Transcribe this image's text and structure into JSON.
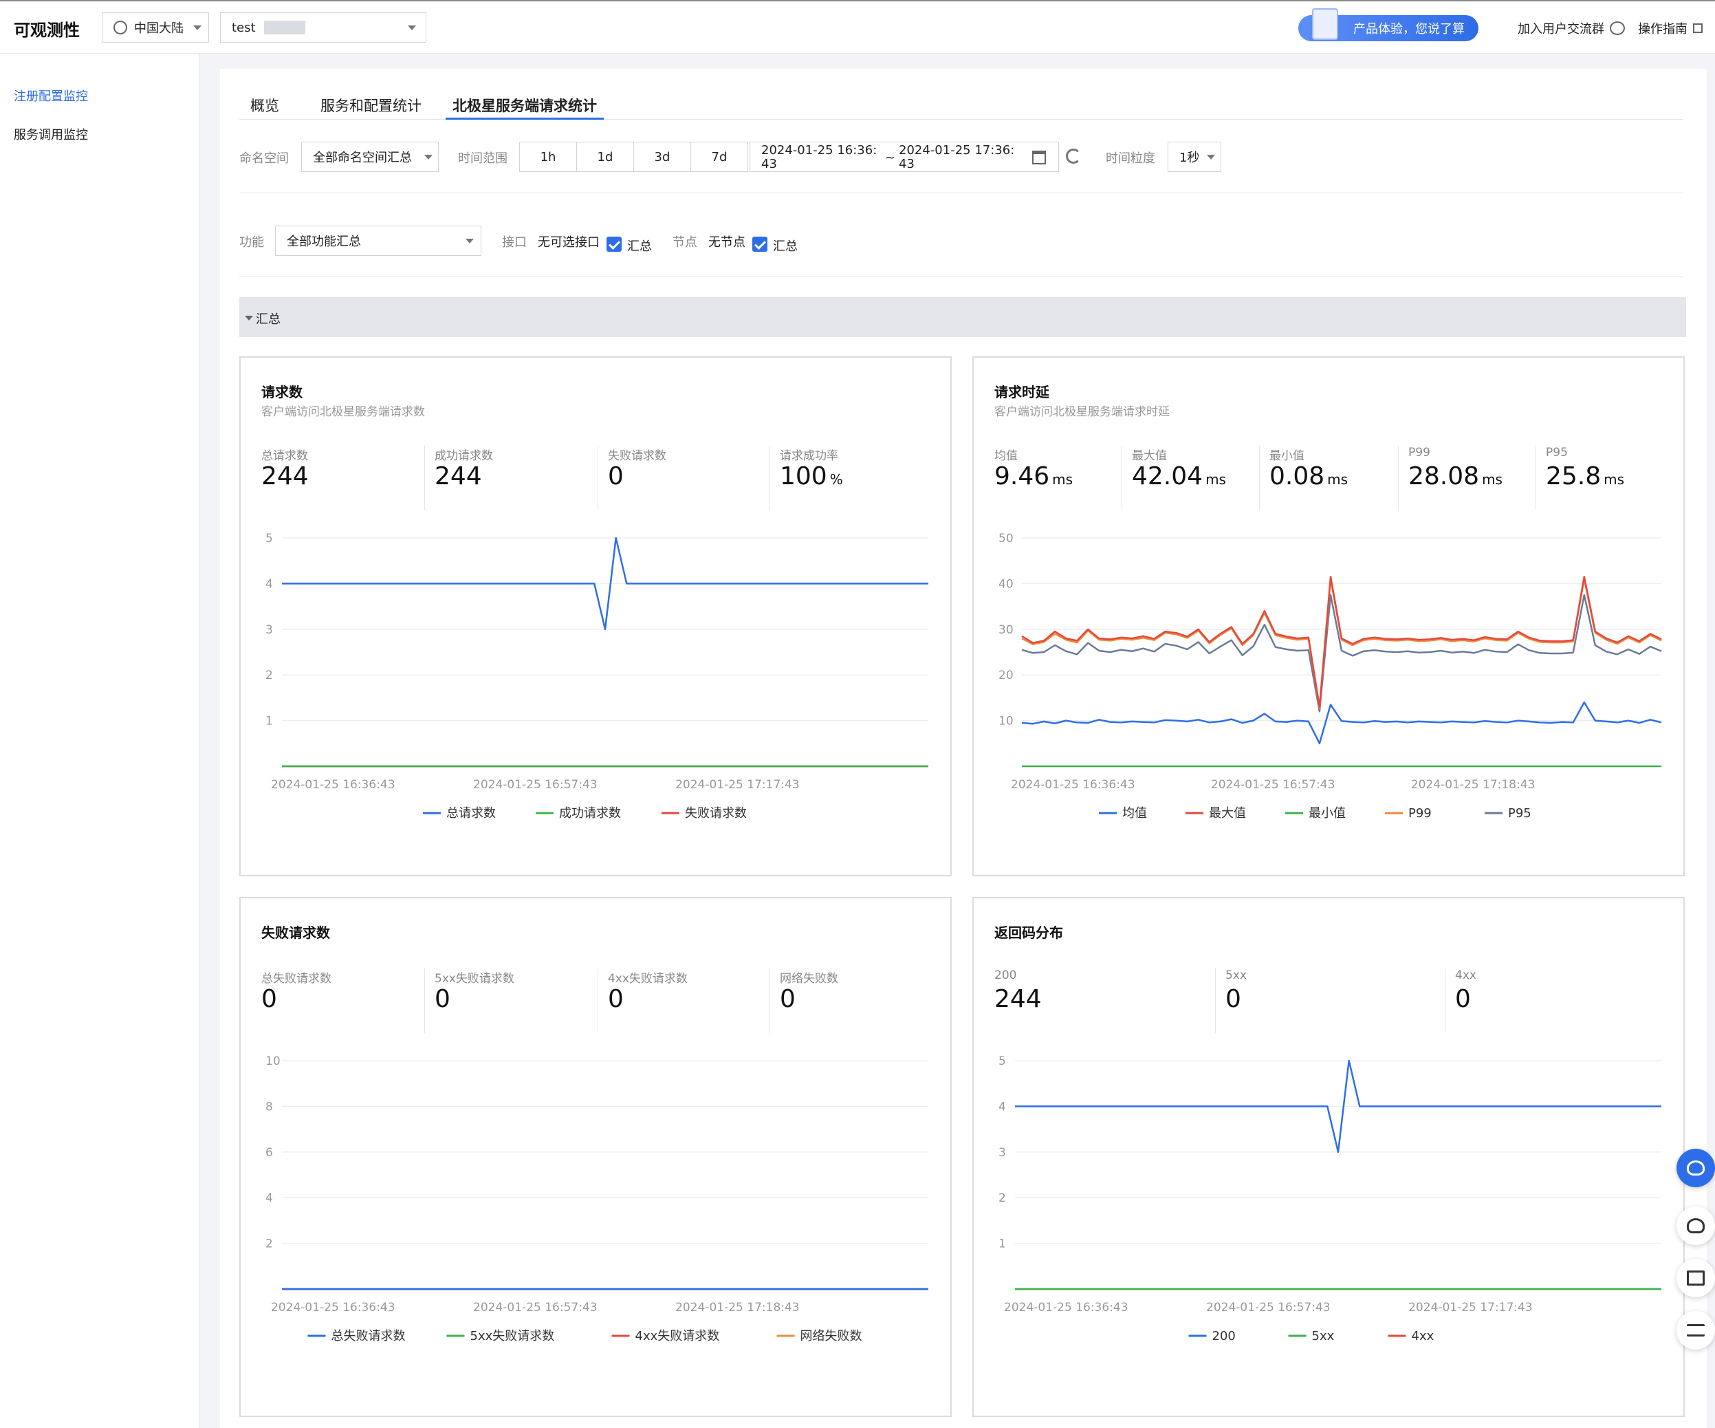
{
  "header": {
    "app_title": "可观测性",
    "region": "中国大陆",
    "instance": "test",
    "promo": "产品体验，您说了算",
    "join_group": "加入用户交流群",
    "guide": "操作指南"
  },
  "sidebar": {
    "items": [
      {
        "label": "注册配置监控",
        "active": true
      },
      {
        "label": "服务调用监控",
        "active": false
      }
    ]
  },
  "tabs": [
    {
      "label": "概览"
    },
    {
      "label": "服务和配置统计"
    },
    {
      "label": "北极星服务端请求统计",
      "active": true
    }
  ],
  "filters": {
    "namespace_label": "命名空间",
    "namespace_value": "全部命名空间汇总",
    "time_range_label": "时间范围",
    "ranges": [
      "1h",
      "1d",
      "3d",
      "7d"
    ],
    "start": "2024-01-25 16:36:43",
    "start_l1": "2024-01-25 16:36:",
    "start_l2": "43",
    "end": "2024-01-25 17:36:43",
    "end_l1": "2024-01-25 17:36:",
    "end_l2": "43",
    "tilde": "~",
    "granularity_label": "时间粒度",
    "granularity_value": "1秒",
    "function_label": "功能",
    "function_value": "全部功能汇总",
    "interface_label": "接口",
    "interface_value": "无可选接口",
    "summary_label": "汇总",
    "node_label": "节点",
    "node_value": "无节点"
  },
  "section": {
    "title": "汇总"
  },
  "colors": {
    "blue": "#2d6ee8",
    "green": "#3cb14a",
    "red": "#e5483c",
    "orange": "#f08a3c",
    "slate": "#6b7a99"
  },
  "cards": {
    "requests": {
      "title": "请求数",
      "subtitle": "客户端访问北极星服务端请求数",
      "stats": [
        {
          "label": "总请求数",
          "value": "244",
          "unit": ""
        },
        {
          "label": "成功请求数",
          "value": "244",
          "unit": ""
        },
        {
          "label": "失败请求数",
          "value": "0",
          "unit": ""
        },
        {
          "label": "请求成功率",
          "value": "100",
          "unit": "%"
        }
      ]
    },
    "latency": {
      "title": "请求时延",
      "subtitle": "客户端访问北极星服务端请求时延",
      "stats": [
        {
          "label": "均值",
          "value": "9.46",
          "unit": "ms"
        },
        {
          "label": "最大值",
          "value": "42.04",
          "unit": "ms"
        },
        {
          "label": "最小值",
          "value": "0.08",
          "unit": "ms"
        },
        {
          "label": "P99",
          "value": "28.08",
          "unit": "ms"
        },
        {
          "label": "P95",
          "value": "25.8",
          "unit": "ms"
        }
      ]
    },
    "failures": {
      "title": "失败请求数",
      "stats": [
        {
          "label": "总失败请求数",
          "value": "0",
          "unit": ""
        },
        {
          "label": "5xx失败请求数",
          "value": "0",
          "unit": ""
        },
        {
          "label": "4xx失败请求数",
          "value": "0",
          "unit": ""
        },
        {
          "label": "网络失败数",
          "value": "0",
          "unit": ""
        }
      ]
    },
    "codes": {
      "title": "返回码分布",
      "stats": [
        {
          "label": "200",
          "value": "244",
          "unit": ""
        },
        {
          "label": "5xx",
          "value": "0",
          "unit": ""
        },
        {
          "label": "4xx",
          "value": "0",
          "unit": ""
        }
      ]
    }
  },
  "chart_data": [
    {
      "type": "line",
      "id": "requests",
      "yticks": [
        1,
        2,
        3,
        4,
        5
      ],
      "ylim": [
        0,
        5
      ],
      "x_tick_labels": [
        "2024-01-25 16:36:43",
        "2024-01-25 16:57:43",
        "2024-01-25 17:17:43"
      ],
      "x_tick_pos": [
        0,
        0.34,
        0.68
      ],
      "series": [
        {
          "name": "总请求数",
          "color": "#2d6ee8",
          "values": [
            4,
            4,
            4,
            4,
            4,
            4,
            4,
            4,
            4,
            4,
            4,
            4,
            4,
            4,
            4,
            4,
            4,
            4,
            4,
            4,
            4,
            4,
            4,
            4,
            4,
            4,
            4,
            4,
            4,
            4,
            3,
            5,
            4,
            4,
            4,
            4,
            4,
            4,
            4,
            4,
            4,
            4,
            4,
            4,
            4,
            4,
            4,
            4,
            4,
            4,
            4,
            4,
            4,
            4,
            4,
            4,
            4,
            4,
            4,
            4,
            4
          ]
        },
        {
          "name": "成功请求数",
          "color": "#3cb14a",
          "values": [
            0,
            0
          ]
        },
        {
          "name": "失败请求数",
          "color": "#e5483c",
          "values": [
            0,
            0
          ]
        }
      ]
    },
    {
      "type": "line",
      "id": "latency",
      "yticks": [
        10,
        20,
        30,
        40,
        50
      ],
      "ylim": [
        0,
        50
      ],
      "x_tick_labels": [
        "2024-01-25 16:36:43",
        "2024-01-25 16:57:43",
        "2024-01-25 17:18:43"
      ],
      "x_tick_pos": [
        0,
        0.34,
        0.68
      ],
      "series": [
        {
          "name": "均值",
          "color": "#2d6ee8",
          "values": [
            9.5,
            9.3,
            9.8,
            9.4,
            10,
            9.6,
            9.5,
            10.2,
            9.7,
            9.6,
            9.8,
            9.7,
            9.6,
            10.1,
            10,
            9.8,
            10.2,
            9.6,
            9.8,
            10.3,
            9.5,
            10,
            11.5,
            9.8,
            9.7,
            10,
            9.8,
            5,
            13.5,
            9.9,
            9.7,
            9.6,
            9.9,
            9.7,
            9.8,
            9.6,
            9.8,
            9.7,
            9.6,
            9.8,
            9.7,
            9.6,
            9.9,
            9.7,
            9.6,
            10,
            9.8,
            9.6,
            9.5,
            9.7,
            9.6,
            14,
            10,
            9.8,
            9.6,
            10,
            9.5,
            10.2,
            9.6
          ]
        },
        {
          "name": "最大值",
          "color": "#e5483c",
          "values": [
            28.5,
            27,
            27.5,
            29.5,
            28,
            27.5,
            30,
            28,
            27.8,
            28.2,
            28,
            28.5,
            27.9,
            29.5,
            29.2,
            28.4,
            30,
            27.2,
            29,
            30.5,
            26.8,
            29,
            34,
            29,
            28.4,
            28,
            28.2,
            13,
            41.5,
            28,
            26.8,
            27.9,
            28.2,
            27.9,
            27.8,
            28,
            27.7,
            27.8,
            28.1,
            27.7,
            27.9,
            27.6,
            28.3,
            27.9,
            27.8,
            29.5,
            28.2,
            27.5,
            27.4,
            27.4,
            27.6,
            41.5,
            29.5,
            28,
            27.1,
            28.5,
            27.4,
            29,
            27.8
          ]
        },
        {
          "name": "最小值",
          "color": "#3cb14a",
          "values": [
            0,
            0
          ]
        },
        {
          "name": "P99",
          "color": "#f08a3c",
          "values": [
            28,
            26.7,
            27.2,
            29,
            27.7,
            27.1,
            29.7,
            27.7,
            27.5,
            27.9,
            27.7,
            28.1,
            27.6,
            29.2,
            28.9,
            28.1,
            29.7,
            26.9,
            28.7,
            30.2,
            26.5,
            28.7,
            33.6,
            28.7,
            28.1,
            27.7,
            27.9,
            12.7,
            41,
            27.7,
            26.5,
            27.6,
            27.9,
            27.6,
            27.5,
            27.7,
            27.4,
            27.5,
            27.8,
            27.4,
            27.6,
            27.3,
            28,
            27.6,
            27.5,
            29.2,
            27.9,
            27.2,
            27.1,
            27.1,
            27.3,
            41,
            29.2,
            27.7,
            26.8,
            28.2,
            27.1,
            28.7,
            27.5
          ]
        },
        {
          "name": "P95",
          "color": "#6b7a99",
          "values": [
            25.5,
            24.8,
            25,
            26.5,
            25.2,
            24.5,
            27,
            25.3,
            25,
            25.5,
            25.2,
            25.8,
            25.1,
            26.8,
            26.4,
            25.6,
            27.2,
            24.7,
            26.2,
            27.6,
            24.3,
            26.3,
            31,
            26.1,
            25.6,
            25.3,
            25.4,
            12,
            37.5,
            25.3,
            24.2,
            25.2,
            25.4,
            25.1,
            25,
            25.2,
            24.9,
            25,
            25.3,
            24.9,
            25.1,
            24.8,
            25.5,
            25.1,
            25,
            26.7,
            25.4,
            24.8,
            24.7,
            24.7,
            24.9,
            37.5,
            26.5,
            25.1,
            24.5,
            25.6,
            24.6,
            26.2,
            25.2
          ]
        }
      ]
    },
    {
      "type": "line",
      "id": "failures",
      "yticks": [
        2,
        4,
        6,
        8,
        10
      ],
      "ylim": [
        0,
        10
      ],
      "x_tick_labels": [
        "2024-01-25 16:36:43",
        "2024-01-25 16:57:43",
        "2024-01-25 17:18:43"
      ],
      "x_tick_pos": [
        0,
        0.34,
        0.68
      ],
      "series": [
        {
          "name": "总失败请求数",
          "color": "#2d6ee8",
          "values": [
            0,
            0
          ]
        },
        {
          "name": "5xx失败请求数",
          "color": "#3cb14a",
          "values": [
            0,
            0
          ]
        },
        {
          "name": "4xx失败请求数",
          "color": "#e5483c",
          "values": [
            0,
            0
          ]
        },
        {
          "name": "网络失败数",
          "color": "#f08a3c",
          "values": [
            0,
            0
          ]
        }
      ]
    },
    {
      "type": "line",
      "id": "codes",
      "yticks": [
        1,
        2,
        3,
        4,
        5
      ],
      "ylim": [
        0,
        5
      ],
      "x_tick_labels": [
        "2024-01-25 16:36:43",
        "2024-01-25 16:57:43",
        "2024-01-25 17:17:43"
      ],
      "x_tick_pos": [
        0,
        0.34,
        0.68
      ],
      "series": [
        {
          "name": "200",
          "color": "#2d6ee8",
          "values": [
            4,
            4,
            4,
            4,
            4,
            4,
            4,
            4,
            4,
            4,
            4,
            4,
            4,
            4,
            4,
            4,
            4,
            4,
            4,
            4,
            4,
            4,
            4,
            4,
            4,
            4,
            4,
            4,
            4,
            4,
            3,
            5,
            4,
            4,
            4,
            4,
            4,
            4,
            4,
            4,
            4,
            4,
            4,
            4,
            4,
            4,
            4,
            4,
            4,
            4,
            4,
            4,
            4,
            4,
            4,
            4,
            4,
            4,
            4,
            4,
            4
          ]
        },
        {
          "name": "5xx",
          "color": "#3cb14a",
          "values": [
            0,
            0
          ]
        },
        {
          "name": "4xx",
          "color": "#e5483c",
          "values": [
            0,
            0
          ]
        }
      ]
    }
  ]
}
